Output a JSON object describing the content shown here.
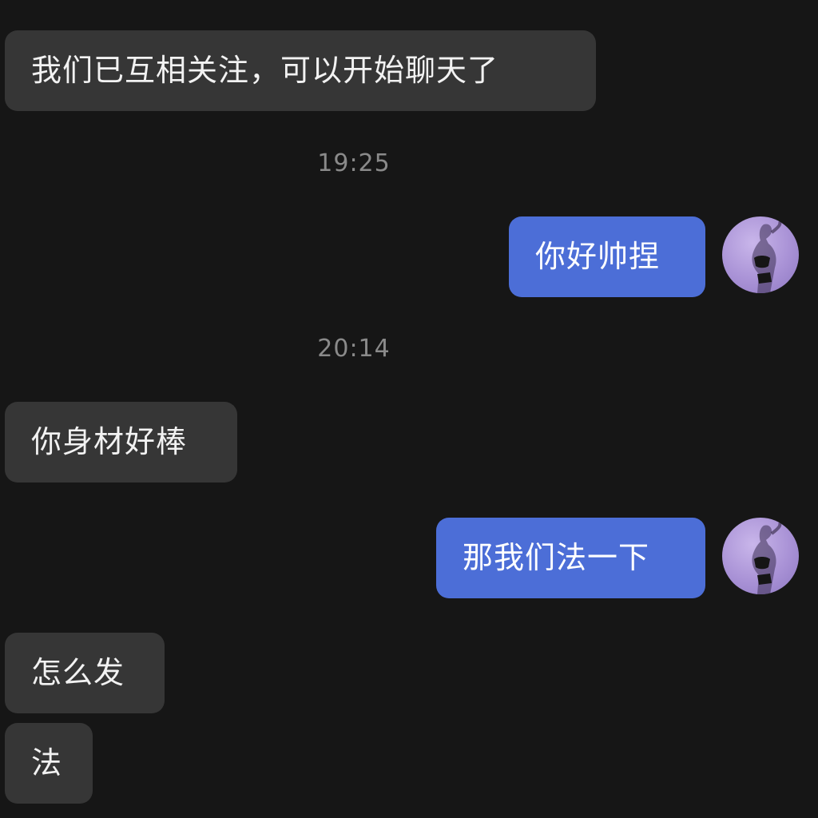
{
  "messages": [
    {
      "side": "incoming",
      "text": "我们已互相关注，可以开始聊天了"
    },
    {
      "side": "timestamp",
      "text": "19:25"
    },
    {
      "side": "outgoing",
      "text": "你好帅捏"
    },
    {
      "side": "timestamp",
      "text": "20:14"
    },
    {
      "side": "incoming",
      "text": "你身材好棒"
    },
    {
      "side": "outgoing",
      "text": "那我们法一下"
    },
    {
      "side": "incoming",
      "text": "怎么发"
    },
    {
      "side": "incoming",
      "text": "法"
    }
  ],
  "colors": {
    "background": "#161616",
    "incoming_bubble": "#363636",
    "outgoing_bubble": "#4c6ed7",
    "timestamp_text": "#8a8a8a",
    "avatar_bg": "#b39fe0"
  },
  "icons": {
    "avatar": "user-avatar-photo"
  }
}
